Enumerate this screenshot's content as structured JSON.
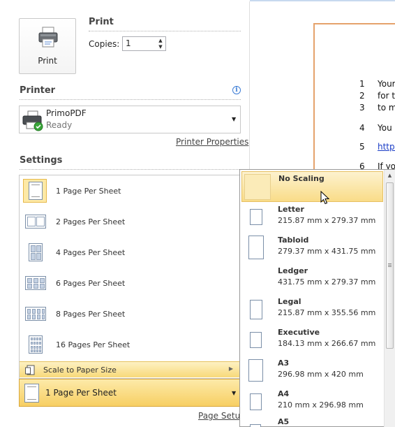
{
  "print": {
    "button_label": "Print",
    "section_title": "Print",
    "copies_label": "Copies:",
    "copies_value": "1"
  },
  "printer": {
    "section_title": "Printer",
    "name": "PrimoPDF",
    "status": "Ready",
    "properties_link": "Printer Properties"
  },
  "settings": {
    "section_title": "Settings",
    "pages_per_sheet_options": [
      {
        "label": "1 Page Per Sheet",
        "icon": "one-page-icon"
      },
      {
        "label": "2 Pages Per Sheet",
        "icon": "two-pages-icon"
      },
      {
        "label": "4 Pages Per Sheet",
        "icon": "four-pages-icon"
      },
      {
        "label": "6 Pages Per Sheet",
        "icon": "six-pages-icon"
      },
      {
        "label": "8 Pages Per Sheet",
        "icon": "eight-pages-icon"
      },
      {
        "label": "16 Pages Per Sheet",
        "icon": "sixteen-pages-icon"
      }
    ],
    "scale_label": "Scale to Paper Size",
    "selected_value": "1 Page Per Sheet",
    "page_setup_link": "Page Setup"
  },
  "paper_sizes": [
    {
      "name": "No Scaling",
      "dims": ""
    },
    {
      "name": "Letter",
      "dims": "215.87 mm x 279.37 mm"
    },
    {
      "name": "Tabloid",
      "dims": "279.37 mm x 431.75 mm"
    },
    {
      "name": "Ledger",
      "dims": "431.75 mm x 279.37 mm"
    },
    {
      "name": "Legal",
      "dims": "215.87 mm x 355.56 mm"
    },
    {
      "name": "Executive",
      "dims": "184.13 mm x 266.67 mm"
    },
    {
      "name": "A3",
      "dims": "296.98 mm x 420 mm"
    },
    {
      "name": "A4",
      "dims": "210 mm x 296.98 mm"
    },
    {
      "name": "A5",
      "dims": ""
    }
  ],
  "preview": {
    "lines": [
      {
        "num": "1",
        "text": "Your"
      },
      {
        "num": "2",
        "text": "for th"
      },
      {
        "num": "3",
        "text": "to my"
      },
      {
        "num": "4",
        "text": "You c"
      },
      {
        "num": "5",
        "text": "https"
      },
      {
        "num": "6",
        "text": "If you"
      }
    ]
  },
  "colors": {
    "selection_fill": "#fde9a6",
    "selection_border": "#e6b94a",
    "link_blue": "#1a3cc6",
    "preview_border": "#e5a26b"
  }
}
